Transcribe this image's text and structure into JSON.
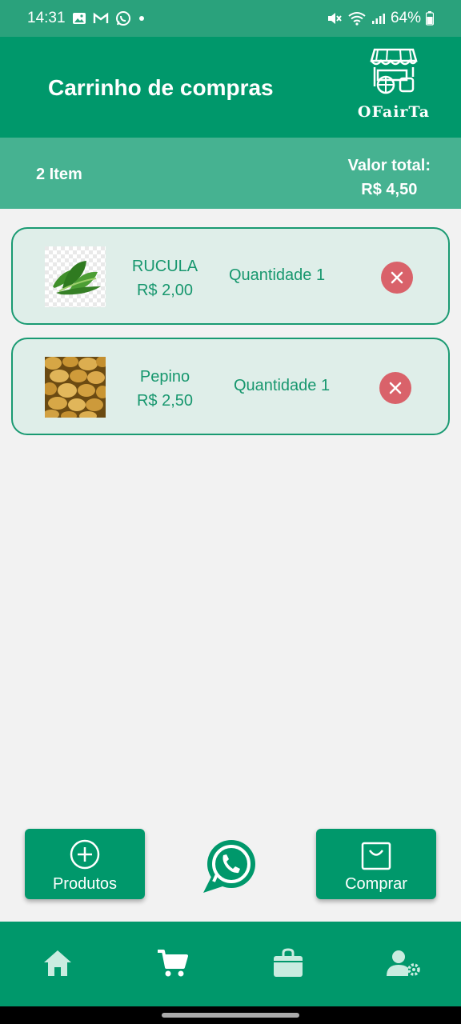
{
  "status_bar": {
    "time": "14:31",
    "battery": "64%",
    "left_icons": [
      "gallery-icon",
      "gmail-icon",
      "whatsapp-icon",
      "dot-icon"
    ],
    "right_icons": [
      "mute-icon",
      "wifi-icon",
      "signal-icon",
      "battery-icon"
    ]
  },
  "header": {
    "title": "Carrinho de compras",
    "logo_text": "OFairTa",
    "logo_icon": "market-stall-icon"
  },
  "summary": {
    "item_count": "2 Item",
    "total_label": "Valor total:",
    "total_value": "R$ 4,50"
  },
  "cart": {
    "items": [
      {
        "name": "RUCULA",
        "price": "R$ 2,00",
        "quantity": "Quantidade 1",
        "image": "arugula-image"
      },
      {
        "name": "Pepino",
        "price": "R$ 2,50",
        "quantity": "Quantidade 1",
        "image": "potatoes-image"
      }
    ]
  },
  "actions": {
    "products_label": "Produtos",
    "buy_label": "Comprar"
  },
  "nav": {
    "items": [
      "home-icon",
      "cart-icon",
      "shopping-bag-icon",
      "user-settings-icon"
    ]
  },
  "colors": {
    "primary": "#00986b",
    "status_bar": "#2aa27c",
    "summary_bar": "#46b291",
    "card_bg": "#dfeee9",
    "remove": "#d9626a"
  }
}
